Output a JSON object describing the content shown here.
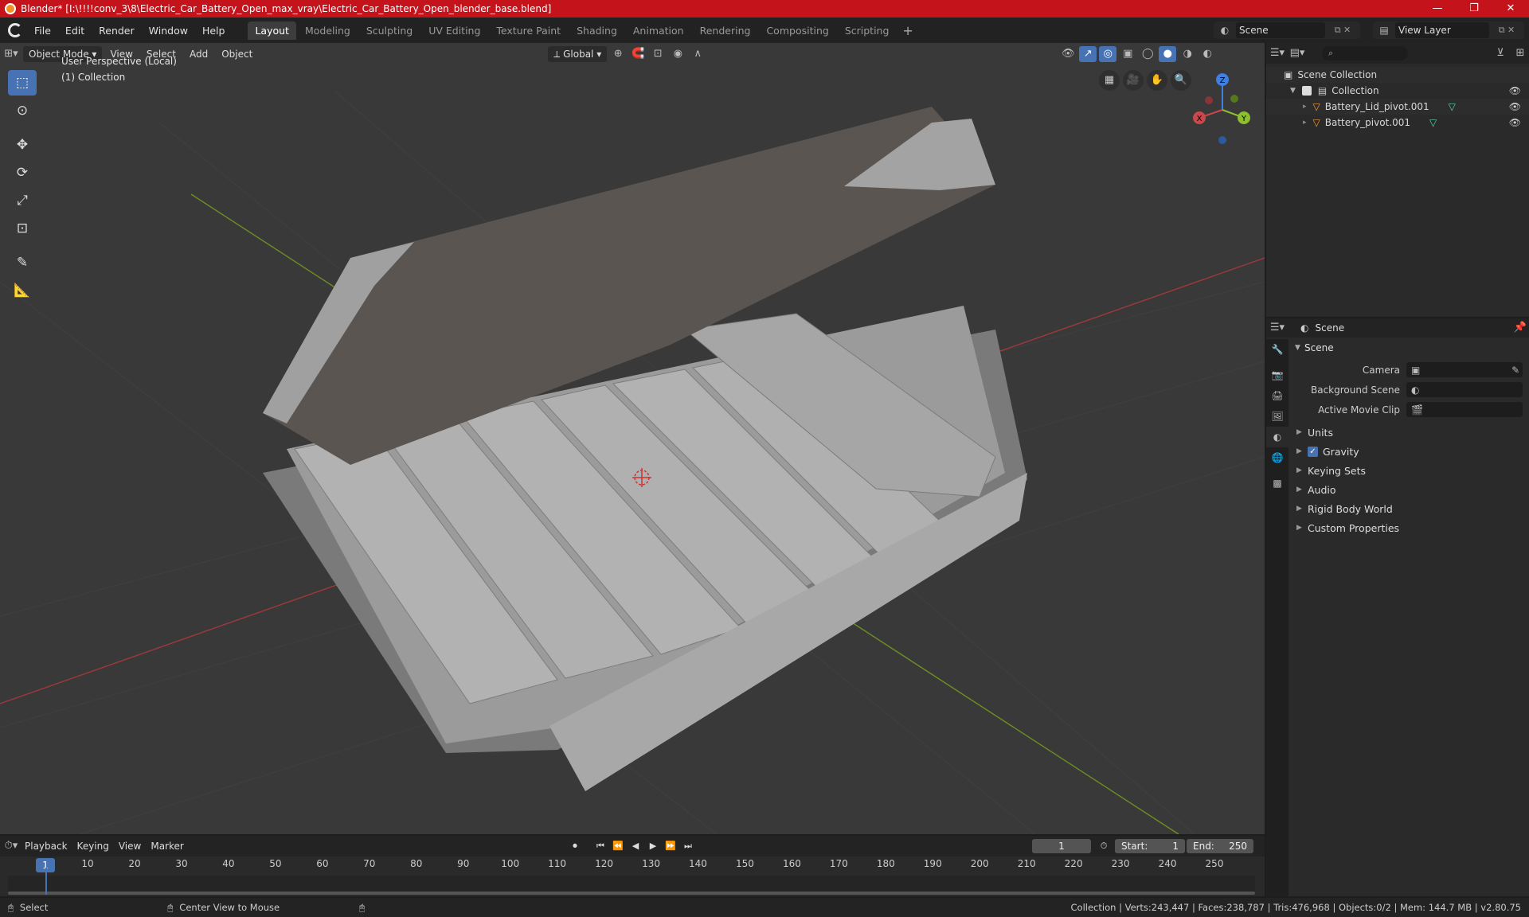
{
  "window": {
    "title": "Blender* [I:\\!!!!conv_3\\8\\Electric_Car_Battery_Open_max_vray\\Electric_Car_Battery_Open_blender_base.blend]",
    "controls": [
      "—",
      "❐",
      "✕"
    ]
  },
  "menubar": {
    "menus": [
      "File",
      "Edit",
      "Render",
      "Window",
      "Help"
    ],
    "workspaces": [
      "Layout",
      "Modeling",
      "Sculpting",
      "UV Editing",
      "Texture Paint",
      "Shading",
      "Animation",
      "Rendering",
      "Compositing",
      "Scripting"
    ],
    "active_workspace": "Layout",
    "add_label": "+",
    "scene": "Scene",
    "view_layer": "View Layer"
  },
  "viewport": {
    "mode": "Object Mode",
    "menus": [
      "View",
      "Select",
      "Add",
      "Object"
    ],
    "orientation": "Global",
    "perspective_label": "User Perspective (Local)",
    "collection_label": "(1) Collection",
    "gizmo_axes": [
      "X",
      "Y",
      "Z"
    ]
  },
  "outliner": {
    "search_placeholder": "",
    "root": "Scene Collection",
    "collection": "Collection",
    "objects": [
      "Battery_Lid_pivot.001",
      "Battery_pivot.001"
    ]
  },
  "properties": {
    "context": "Scene",
    "panel_title": "Scene",
    "fields": [
      {
        "label": "Camera",
        "value": ""
      },
      {
        "label": "Background Scene",
        "value": ""
      },
      {
        "label": "Active Movie Clip",
        "value": ""
      }
    ],
    "subpanels": [
      "Units",
      "Gravity",
      "Keying Sets",
      "Audio",
      "Rigid Body World",
      "Custom Properties"
    ],
    "gravity_enabled": true
  },
  "timeline": {
    "menus": [
      "Playback",
      "Keying",
      "View",
      "Marker"
    ],
    "current_frame": "1",
    "start_label": "Start:",
    "start": "1",
    "end_label": "End:",
    "end": "250",
    "ticks": [
      "1",
      "10",
      "20",
      "30",
      "40",
      "50",
      "60",
      "70",
      "80",
      "90",
      "100",
      "110",
      "120",
      "130",
      "140",
      "150",
      "160",
      "170",
      "180",
      "190",
      "200",
      "210",
      "220",
      "230",
      "240",
      "250"
    ]
  },
  "statusbar": {
    "left_action": "Select",
    "middle_action": "Center View to Mouse",
    "stats": "Collection | Verts:243,447 | Faces:238,787 | Tris:476,968 | Objects:0/2 | Mem: 144.7 MB | v2.80.75"
  },
  "colors": {
    "titlebar": "#c5131b",
    "accent": "#4772b3",
    "viewport_bg": "#393939",
    "x_axis": "#c8484e",
    "y_axis": "#8bbf2e",
    "z_axis": "#3e7fe0"
  }
}
